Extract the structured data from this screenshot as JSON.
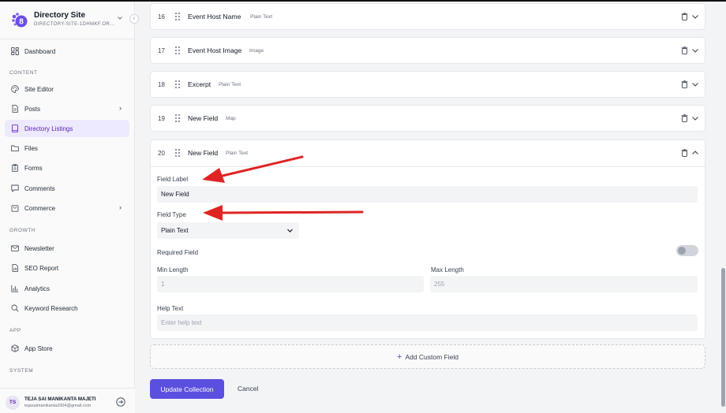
{
  "brand": {
    "name": "Directory Site",
    "subtitle": "DIRECTORY-SITE-1DHMKF.OR...",
    "chevron_icon": "chevron-down-icon"
  },
  "sidebar": {
    "collapse_glyph": "‹",
    "sections": {
      "content": "CONTENT",
      "growth": "GROWTH",
      "app": "APP",
      "system": "SYSTEM"
    },
    "items": [
      {
        "label": "Dashboard",
        "icon": "dashboard-icon"
      },
      {
        "label": "Site Editor",
        "icon": "palette-icon"
      },
      {
        "label": "Posts",
        "icon": "document-icon",
        "has_submenu": true
      },
      {
        "label": "Directory Listings",
        "icon": "book-icon",
        "active": true
      },
      {
        "label": "Files",
        "icon": "folder-icon"
      },
      {
        "label": "Forms",
        "icon": "clipboard-icon"
      },
      {
        "label": "Comments",
        "icon": "comment-icon"
      },
      {
        "label": "Commerce",
        "icon": "cart-icon",
        "has_submenu": true
      },
      {
        "label": "Newsletter",
        "icon": "mail-icon"
      },
      {
        "label": "SEO Report",
        "icon": "report-icon"
      },
      {
        "label": "Analytics",
        "icon": "bar-chart-icon"
      },
      {
        "label": "Keyword Research",
        "icon": "search-icon"
      },
      {
        "label": "App Store",
        "icon": "cube-icon"
      }
    ],
    "submenu_glyph": "›"
  },
  "user": {
    "initials": "TS",
    "name": "TEJA SAI MANIKANTA MAJETI",
    "email": "tejasaimanikanta2004@gmail.com"
  },
  "fields": [
    {
      "num": "16",
      "name": "Event Host Name",
      "type": "Plain Text"
    },
    {
      "num": "17",
      "name": "Event Host Image",
      "type": "Image"
    },
    {
      "num": "18",
      "name": "Excerpt",
      "type": "Plain Text"
    },
    {
      "num": "19",
      "name": "New Field",
      "type": "Map"
    }
  ],
  "expanded_field": {
    "num": "20",
    "name": "New Field",
    "type": "Plain Text",
    "field_label_label": "Field Label",
    "field_label_value": "New Field",
    "field_type_label": "Field Type",
    "field_type_value": "Plain Text",
    "required_label": "Required Field",
    "required_on": false,
    "min_length_label": "Min Length",
    "min_length_placeholder": "1",
    "max_length_label": "Max Length",
    "max_length_placeholder": "255",
    "help_text_label": "Help Text",
    "help_text_placeholder": "Enter help text"
  },
  "actions": {
    "add_custom_field": "Add Custom Field",
    "add_glyph": "+",
    "update": "Update Collection",
    "cancel": "Cancel"
  },
  "colors": {
    "accent": "#5b4fe0",
    "active_bg": "#ede9fe",
    "annotation_arrow": "#e02424"
  }
}
